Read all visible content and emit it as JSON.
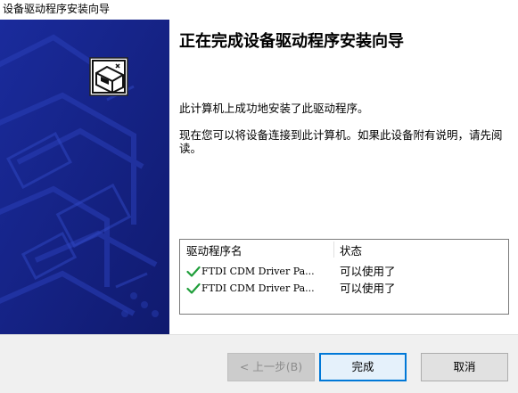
{
  "window": {
    "title": "设备驱动程序安装向导"
  },
  "banner": {
    "icon": "hardware-install-icon",
    "background_color": "#1a2a8f"
  },
  "content": {
    "heading": "正在完成设备驱动程序安装向导",
    "paragraph1": "此计算机上成功地安装了此驱动程序。",
    "paragraph2": "现在您可以将设备连接到此计算机。如果此设备附有说明，请先阅读。"
  },
  "driver_list": {
    "columns": [
      "驱动程序名",
      "状态"
    ],
    "rows": [
      {
        "icon": "green-check-icon",
        "name": "FTDI CDM Driver Pa...",
        "status": "可以使用了"
      },
      {
        "icon": "green-check-icon",
        "name": "FTDI CDM Driver Pa...",
        "status": "可以使用了"
      }
    ]
  },
  "buttons": {
    "back": "< 上一步(B)",
    "finish": "完成",
    "cancel": "取消"
  },
  "colors": {
    "accent": "#0078d7",
    "check": "#1f9e3a"
  }
}
